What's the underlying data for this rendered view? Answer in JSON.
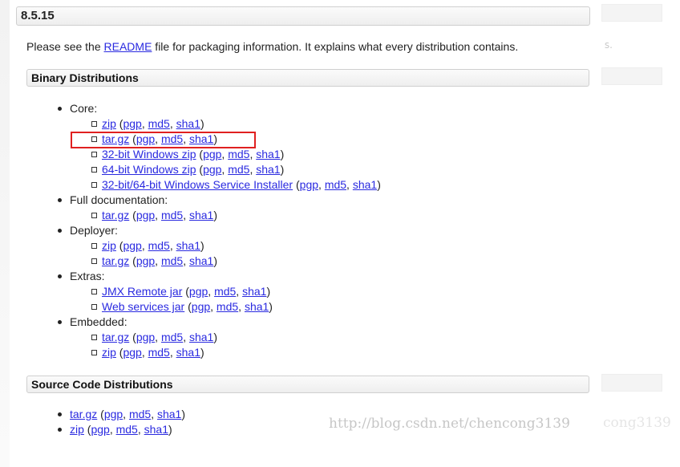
{
  "version_title": "8.5.15",
  "intro": {
    "before": "Please see the ",
    "link": "README",
    "after": " file for packaging information. It explains what every distribution contains."
  },
  "binary_title": "Binary Distributions",
  "source_title": "Source Code Distributions",
  "binary_groups": [
    {
      "label": "Core:",
      "items": [
        {
          "main": "zip",
          "sigs": [
            "pgp",
            "md5",
            "sha1"
          ]
        },
        {
          "main": "tar.gz",
          "sigs": [
            "pgp",
            "md5",
            "sha1"
          ]
        },
        {
          "main": "32-bit Windows zip",
          "sigs": [
            "pgp",
            "md5",
            "sha1"
          ]
        },
        {
          "main": "64-bit Windows zip",
          "sigs": [
            "pgp",
            "md5",
            "sha1"
          ]
        },
        {
          "main": "32-bit/64-bit Windows Service Installer",
          "sigs": [
            "pgp",
            "md5",
            "sha1"
          ]
        }
      ]
    },
    {
      "label": "Full documentation:",
      "items": [
        {
          "main": "tar.gz",
          "sigs": [
            "pgp",
            "md5",
            "sha1"
          ]
        }
      ]
    },
    {
      "label": "Deployer:",
      "items": [
        {
          "main": "zip",
          "sigs": [
            "pgp",
            "md5",
            "sha1"
          ]
        },
        {
          "main": "tar.gz",
          "sigs": [
            "pgp",
            "md5",
            "sha1"
          ]
        }
      ]
    },
    {
      "label": "Extras:",
      "items": [
        {
          "main": "JMX Remote jar",
          "sigs": [
            "pgp",
            "md5",
            "sha1"
          ]
        },
        {
          "main": "Web services jar",
          "sigs": [
            "pgp",
            "md5",
            "sha1"
          ]
        }
      ]
    },
    {
      "label": "Embedded:",
      "items": [
        {
          "main": "tar.gz",
          "sigs": [
            "pgp",
            "md5",
            "sha1"
          ]
        },
        {
          "main": "zip",
          "sigs": [
            "pgp",
            "md5",
            "sha1"
          ]
        }
      ]
    }
  ],
  "source_items": [
    {
      "main": "tar.gz",
      "sigs": [
        "pgp",
        "md5",
        "sha1"
      ]
    },
    {
      "main": "zip",
      "sigs": [
        "pgp",
        "md5",
        "sha1"
      ]
    }
  ],
  "watermark": "http://blog.csdn.net/chencong3139",
  "watermark_ghost": "cong3139",
  "ghost_right_text": "s.",
  "colors": {
    "link": "#2a2ae0",
    "highlight": "#e02020"
  }
}
